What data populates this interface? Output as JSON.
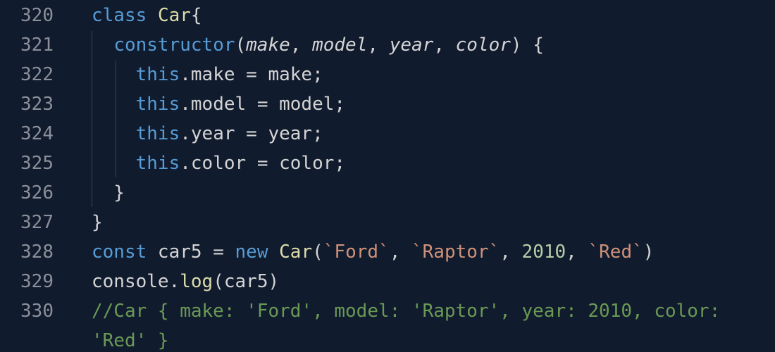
{
  "editor": {
    "lines": [
      {
        "num": "320",
        "tokens": [
          {
            "t": "kw",
            "v": "class"
          },
          {
            "t": "plain",
            "v": " "
          },
          {
            "t": "cls",
            "v": "Car"
          },
          {
            "t": "plain",
            "v": "{"
          }
        ]
      },
      {
        "num": "321",
        "tokens": [
          {
            "t": "plain",
            "v": "  "
          },
          {
            "t": "ctor",
            "v": "constructor"
          },
          {
            "t": "plain",
            "v": "("
          },
          {
            "t": "param",
            "v": "make"
          },
          {
            "t": "plain",
            "v": ", "
          },
          {
            "t": "param",
            "v": "model"
          },
          {
            "t": "plain",
            "v": ", "
          },
          {
            "t": "param",
            "v": "year"
          },
          {
            "t": "plain",
            "v": ", "
          },
          {
            "t": "param",
            "v": "color"
          },
          {
            "t": "plain",
            "v": ") {"
          }
        ]
      },
      {
        "num": "322",
        "tokens": [
          {
            "t": "plain",
            "v": "    "
          },
          {
            "t": "kw",
            "v": "this"
          },
          {
            "t": "plain",
            "v": ".make = make;"
          }
        ]
      },
      {
        "num": "323",
        "tokens": [
          {
            "t": "plain",
            "v": "    "
          },
          {
            "t": "kw",
            "v": "this"
          },
          {
            "t": "plain",
            "v": ".model = model;"
          }
        ]
      },
      {
        "num": "324",
        "tokens": [
          {
            "t": "plain",
            "v": "    "
          },
          {
            "t": "kw",
            "v": "this"
          },
          {
            "t": "plain",
            "v": ".year = year;"
          }
        ]
      },
      {
        "num": "325",
        "tokens": [
          {
            "t": "plain",
            "v": "    "
          },
          {
            "t": "kw",
            "v": "this"
          },
          {
            "t": "plain",
            "v": ".color = color;"
          }
        ]
      },
      {
        "num": "326",
        "tokens": [
          {
            "t": "plain",
            "v": "  }"
          }
        ]
      },
      {
        "num": "327",
        "tokens": [
          {
            "t": "plain",
            "v": "}"
          }
        ]
      },
      {
        "num": "328",
        "tokens": [
          {
            "t": "kw",
            "v": "const"
          },
          {
            "t": "plain",
            "v": " car5 = "
          },
          {
            "t": "kw",
            "v": "new"
          },
          {
            "t": "plain",
            "v": " "
          },
          {
            "t": "cls",
            "v": "Car"
          },
          {
            "t": "plain",
            "v": "("
          },
          {
            "t": "str",
            "v": "`Ford`"
          },
          {
            "t": "plain",
            "v": ", "
          },
          {
            "t": "str",
            "v": "`Raptor`"
          },
          {
            "t": "plain",
            "v": ", "
          },
          {
            "t": "num",
            "v": "2010"
          },
          {
            "t": "plain",
            "v": ", "
          },
          {
            "t": "str",
            "v": "`Red`"
          },
          {
            "t": "plain",
            "v": ")"
          }
        ]
      },
      {
        "num": "329",
        "tokens": [
          {
            "t": "plain",
            "v": "console."
          },
          {
            "t": "fn",
            "v": "log"
          },
          {
            "t": "plain",
            "v": "(car5)"
          }
        ]
      },
      {
        "num": "330",
        "tokens": [
          {
            "t": "com",
            "v": "//Car { make: 'Ford', model: 'Raptor', year: 2010, color:"
          }
        ]
      },
      {
        "num": "",
        "tokens": [
          {
            "t": "com",
            "v": "'Red' }"
          }
        ]
      }
    ]
  },
  "colors": {
    "background": "#111b2e",
    "keyword": "#569cd6",
    "class": "#dcdcaa",
    "string": "#ce9178",
    "number": "#b5cea8",
    "comment": "#6a9955",
    "line_number": "#8a8f98"
  }
}
